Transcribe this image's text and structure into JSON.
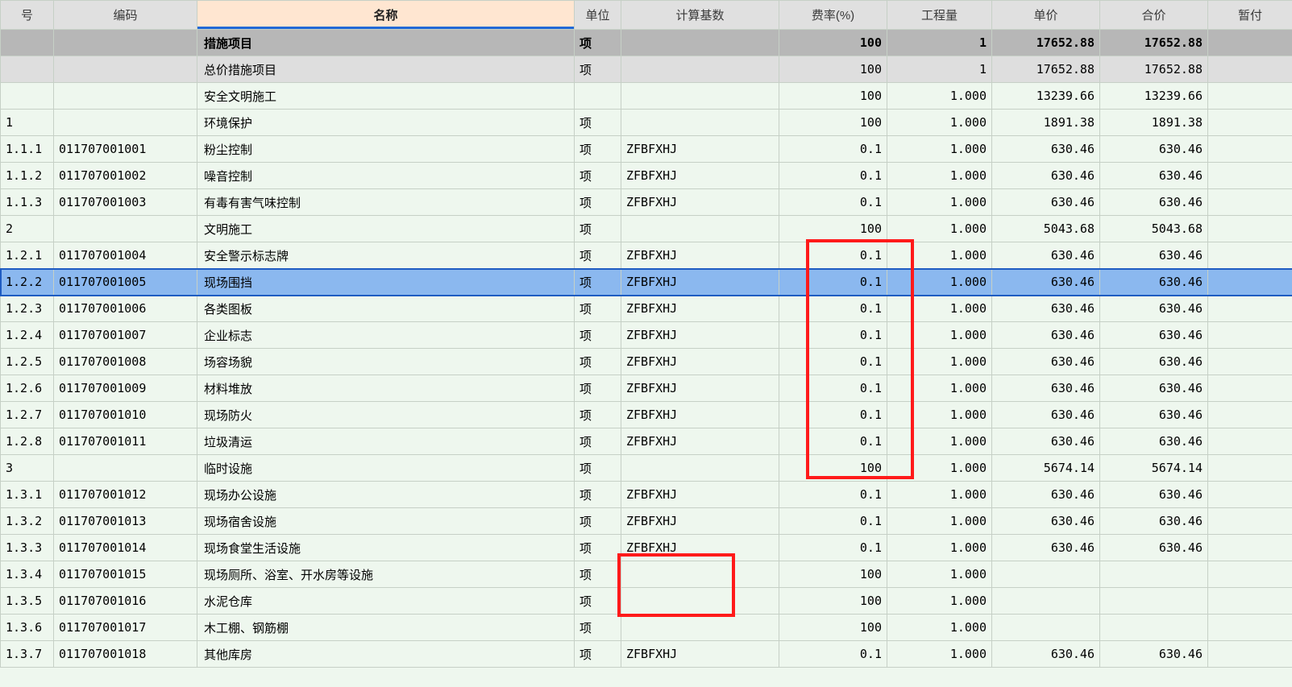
{
  "columns": {
    "seq": "号",
    "code": "编码",
    "name": "名称",
    "unit": "单位",
    "base": "计算基数",
    "rate": "费率(%)",
    "qty": "工程量",
    "price": "单价",
    "total": "合价",
    "temp": "暂付"
  },
  "rows": [
    {
      "type": "subtotal-dark",
      "seq": "",
      "code": "",
      "name": "措施项目",
      "unit": "项",
      "base": "",
      "rate": "100",
      "qty": "1",
      "price": "17652.88",
      "total": "17652.88",
      "temp": ""
    },
    {
      "type": "subtotal-light",
      "seq": "",
      "code": "",
      "name": "总价措施项目",
      "unit": "项",
      "base": "",
      "rate": "100",
      "qty": "1",
      "price": "17652.88",
      "total": "17652.88",
      "temp": ""
    },
    {
      "type": "normal",
      "seq": "",
      "code": "",
      "name": "安全文明施工",
      "unit": "",
      "base": "",
      "rate": "100",
      "qty": "1.000",
      "price": "13239.66",
      "total": "13239.66",
      "temp": ""
    },
    {
      "type": "normal",
      "seq": "1",
      "code": "",
      "name": "环境保护",
      "unit": "项",
      "base": "",
      "rate": "100",
      "qty": "1.000",
      "price": "1891.38",
      "total": "1891.38",
      "temp": ""
    },
    {
      "type": "normal",
      "seq": "1.1.1",
      "code": "011707001001",
      "name": "粉尘控制",
      "unit": "项",
      "base": "ZFBFXHJ",
      "rate": "0.1",
      "qty": "1.000",
      "price": "630.46",
      "total": "630.46",
      "temp": ""
    },
    {
      "type": "normal",
      "seq": "1.1.2",
      "code": "011707001002",
      "name": "噪音控制",
      "unit": "项",
      "base": "ZFBFXHJ",
      "rate": "0.1",
      "qty": "1.000",
      "price": "630.46",
      "total": "630.46",
      "temp": ""
    },
    {
      "type": "normal",
      "seq": "1.1.3",
      "code": "011707001003",
      "name": "有毒有害气味控制",
      "unit": "项",
      "base": "ZFBFXHJ",
      "rate": "0.1",
      "qty": "1.000",
      "price": "630.46",
      "total": "630.46",
      "temp": ""
    },
    {
      "type": "normal",
      "seq": "2",
      "code": "",
      "name": "文明施工",
      "unit": "项",
      "base": "",
      "rate": "100",
      "qty": "1.000",
      "price": "5043.68",
      "total": "5043.68",
      "temp": ""
    },
    {
      "type": "normal",
      "seq": "1.2.1",
      "code": "011707001004",
      "name": "安全警示标志牌",
      "unit": "项",
      "base": "ZFBFXHJ",
      "rate": "0.1",
      "qty": "1.000",
      "price": "630.46",
      "total": "630.46",
      "temp": ""
    },
    {
      "type": "selected",
      "seq": "1.2.2",
      "code": "011707001005",
      "name": "现场围挡",
      "unit": "项",
      "base": "ZFBFXHJ",
      "rate": "0.1",
      "qty": "1.000",
      "price": "630.46",
      "total": "630.46",
      "temp": ""
    },
    {
      "type": "normal",
      "seq": "1.2.3",
      "code": "011707001006",
      "name": "各类图板",
      "unit": "项",
      "base": "ZFBFXHJ",
      "rate": "0.1",
      "qty": "1.000",
      "price": "630.46",
      "total": "630.46",
      "temp": ""
    },
    {
      "type": "normal",
      "seq": "1.2.4",
      "code": "011707001007",
      "name": "企业标志",
      "unit": "项",
      "base": "ZFBFXHJ",
      "rate": "0.1",
      "qty": "1.000",
      "price": "630.46",
      "total": "630.46",
      "temp": ""
    },
    {
      "type": "normal",
      "seq": "1.2.5",
      "code": "011707001008",
      "name": "场容场貌",
      "unit": "项",
      "base": "ZFBFXHJ",
      "rate": "0.1",
      "qty": "1.000",
      "price": "630.46",
      "total": "630.46",
      "temp": ""
    },
    {
      "type": "normal",
      "seq": "1.2.6",
      "code": "011707001009",
      "name": "材料堆放",
      "unit": "项",
      "base": "ZFBFXHJ",
      "rate": "0.1",
      "qty": "1.000",
      "price": "630.46",
      "total": "630.46",
      "temp": ""
    },
    {
      "type": "normal",
      "seq": "1.2.7",
      "code": "011707001010",
      "name": "现场防火",
      "unit": "项",
      "base": "ZFBFXHJ",
      "rate": "0.1",
      "qty": "1.000",
      "price": "630.46",
      "total": "630.46",
      "temp": ""
    },
    {
      "type": "normal",
      "seq": "1.2.8",
      "code": "011707001011",
      "name": "垃圾清运",
      "unit": "项",
      "base": "ZFBFXHJ",
      "rate": "0.1",
      "qty": "1.000",
      "price": "630.46",
      "total": "630.46",
      "temp": ""
    },
    {
      "type": "normal",
      "seq": "3",
      "code": "",
      "name": "临时设施",
      "unit": "项",
      "base": "",
      "rate": "100",
      "qty": "1.000",
      "price": "5674.14",
      "total": "5674.14",
      "temp": ""
    },
    {
      "type": "normal",
      "seq": "1.3.1",
      "code": "011707001012",
      "name": "现场办公设施",
      "unit": "项",
      "base": "ZFBFXHJ",
      "rate": "0.1",
      "qty": "1.000",
      "price": "630.46",
      "total": "630.46",
      "temp": ""
    },
    {
      "type": "normal",
      "seq": "1.3.2",
      "code": "011707001013",
      "name": "现场宿舍设施",
      "unit": "项",
      "base": "ZFBFXHJ",
      "rate": "0.1",
      "qty": "1.000",
      "price": "630.46",
      "total": "630.46",
      "temp": ""
    },
    {
      "type": "normal",
      "seq": "1.3.3",
      "code": "011707001014",
      "name": "现场食堂生活设施",
      "unit": "项",
      "base": "ZFBFXHJ",
      "rate": "0.1",
      "qty": "1.000",
      "price": "630.46",
      "total": "630.46",
      "temp": ""
    },
    {
      "type": "normal",
      "seq": "1.3.4",
      "code": "011707001015",
      "name": "现场厕所、浴室、开水房等设施",
      "unit": "项",
      "base": "",
      "rate": "100",
      "qty": "1.000",
      "price": "",
      "total": "",
      "temp": ""
    },
    {
      "type": "normal",
      "seq": "1.3.5",
      "code": "011707001016",
      "name": "水泥仓库",
      "unit": "项",
      "base": "",
      "rate": "100",
      "qty": "1.000",
      "price": "",
      "total": "",
      "temp": ""
    },
    {
      "type": "normal",
      "seq": "1.3.6",
      "code": "011707001017",
      "name": "木工棚、钢筋棚",
      "unit": "项",
      "base": "",
      "rate": "100",
      "qty": "1.000",
      "price": "",
      "total": "",
      "temp": ""
    },
    {
      "type": "normal",
      "seq": "1.3.7",
      "code": "011707001018",
      "name": "其他库房",
      "unit": "项",
      "base": "ZFBFXHJ",
      "rate": "0.1",
      "qty": "1.000",
      "price": "630.46",
      "total": "630.46",
      "temp": ""
    }
  ]
}
